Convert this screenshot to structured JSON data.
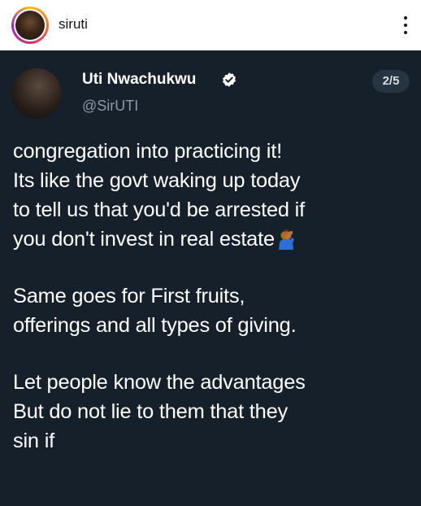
{
  "post": {
    "username": "siruti",
    "more_icon": "more-vertical-icon"
  },
  "tweet": {
    "author_name": "Uti Nwachukwu",
    "verified_icon": "verified-badge-icon",
    "handle": "@SirUTI",
    "page_indicator": "2/5",
    "lines": [
      "congregation into practicing it!",
      "Its like the govt waking up today",
      "to tell us that you'd be arrested if",
      "you don't invest in real estate",
      "Same goes for First fruits,",
      "offerings and all types of giving.",
      "Let people know the advantages",
      "But do not lie to them that they",
      "sin if"
    ],
    "emoji": "facepalm-emoji-icon"
  },
  "colors": {
    "card_background": "#15202b",
    "handle_gray": "#8b98a5",
    "verified_blue": "#ffffff"
  }
}
